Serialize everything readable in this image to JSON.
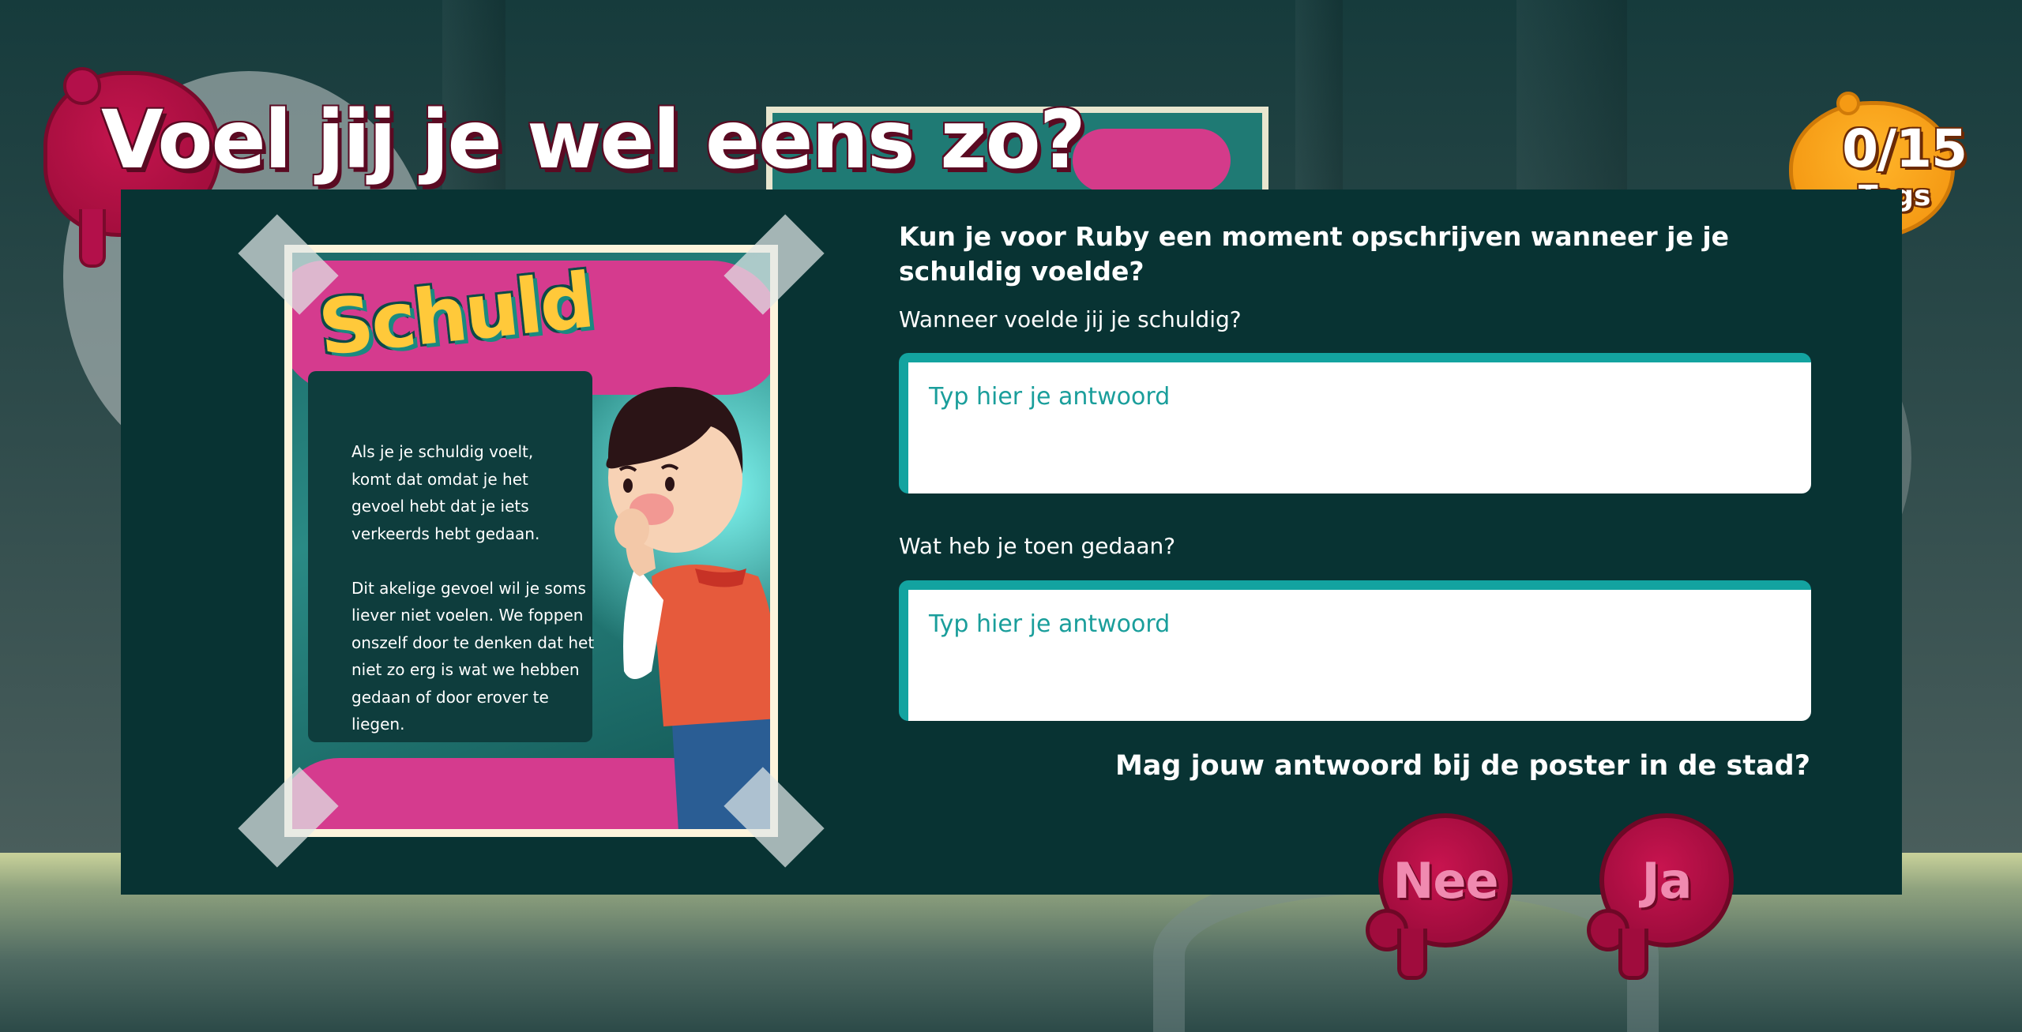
{
  "title": "Voel jij je wel eens zo?",
  "tags": {
    "count": "0/15",
    "label": "Tags"
  },
  "poster": {
    "heading": "Schuld",
    "text": "Als je je schuldig voelt,\nkomt dat omdat je het\ngevoel hebt dat je iets\nverkeerds hebt gedaan.\n\nDit akelige gevoel wil je soms\nliever niet voelen. We foppen\nonszelf door te denken dat het\nniet zo erg is wat we hebben\ngedaan of door erover te\nliegen."
  },
  "form": {
    "main_question": "Kun je voor Ruby een moment opschrijven wanneer je je schuldig voelde?",
    "question1": {
      "label": "Wanneer voelde jij je schuldig?",
      "placeholder": "Typ hier je antwoord"
    },
    "question2": {
      "label": "Wat heb je toen gedaan?",
      "placeholder": "Typ hier je antwoord"
    },
    "share_question": "Mag jouw antwoord bij de poster in de stad?",
    "buttons": {
      "no": "Nee",
      "yes": "Ja"
    }
  },
  "colors": {
    "panel": "#083333",
    "accent_teal": "#13a3a0",
    "splat_red": "#b3104a",
    "splat_orange": "#f59a14",
    "poster_pink": "#d53b8e",
    "poster_yellow": "#ffc93a"
  }
}
